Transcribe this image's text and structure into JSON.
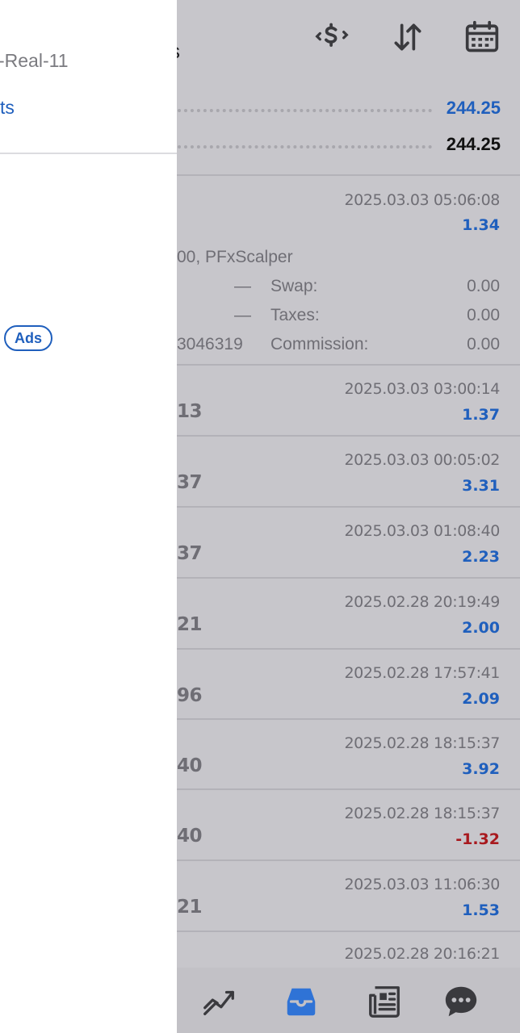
{
  "header": {
    "title_fragment": "s",
    "icons": [
      "currency-exchange-icon",
      "sort-icon",
      "calendar-icon"
    ]
  },
  "summary": [
    {
      "value": "244.25",
      "color": "#1f5fbd"
    },
    {
      "value": "244.25",
      "color": "#111111"
    }
  ],
  "expanded_deal": {
    "time": "2025.03.03 05:06:08",
    "profit": "1.34",
    "comment": "00, PFxScalper",
    "rows": [
      {
        "left": "—",
        "label": "Swap:",
        "value": "0.00"
      },
      {
        "left": "—",
        "label": "Taxes:",
        "value": "0.00"
      },
      {
        "left": "3046319",
        "label": "Commission:",
        "value": "0.00"
      }
    ]
  },
  "deals": [
    {
      "price": "13",
      "time": "2025.03.03 03:00:14",
      "profit": "1.37",
      "negative": false
    },
    {
      "price": "37",
      "time": "2025.03.03 00:05:02",
      "profit": "3.31",
      "negative": false
    },
    {
      "price": "37",
      "time": "2025.03.03 01:08:40",
      "profit": "2.23",
      "negative": false
    },
    {
      "price": "21",
      "time": "2025.02.28 20:19:49",
      "profit": "2.00",
      "negative": false
    },
    {
      "price": "96",
      "time": "2025.02.28 17:57:41",
      "profit": "2.09",
      "negative": false
    },
    {
      "price": "40",
      "time": "2025.02.28 18:15:37",
      "profit": "3.92",
      "negative": false
    },
    {
      "price": "40",
      "time": "2025.02.28 18:15:37",
      "profit": "-1.32",
      "negative": true
    },
    {
      "price": "21",
      "time": "2025.03.03 11:06:30",
      "profit": "1.53",
      "negative": false
    },
    {
      "price": "",
      "time": "2025.02.28 20:16:21",
      "profit": "",
      "negative": false
    }
  ],
  "bottom_nav": {
    "items": [
      "chart-icon",
      "inbox-icon",
      "news-icon",
      "chat-icon"
    ],
    "active_color": "#2f73d6"
  },
  "drawer": {
    "server": "-Real-11",
    "link": "ts",
    "ads_label": "Ads"
  }
}
